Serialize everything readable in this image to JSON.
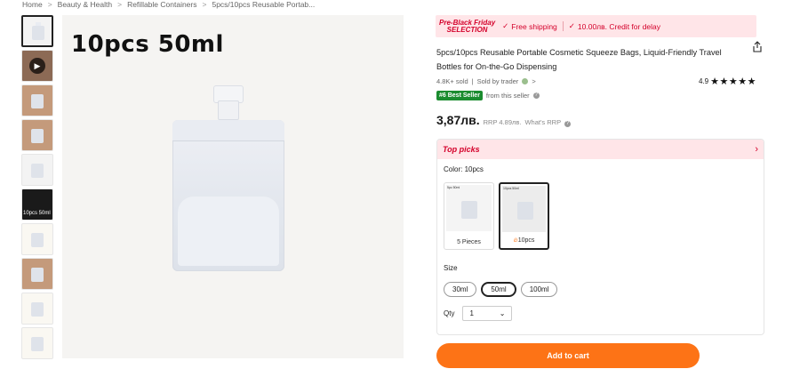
{
  "breadcrumb": {
    "items": [
      "Home",
      "Beauty & Health",
      "Refillable Containers",
      "5pcs/10pcs Reusable Portab..."
    ],
    "separator": ">"
  },
  "gallery": {
    "overlay_text": "10pcs 50ml",
    "thumbnails": [
      {
        "label": "",
        "selected": true
      },
      {
        "label": "",
        "icon": "play-icon"
      },
      {
        "label": ""
      },
      {
        "label": ""
      },
      {
        "label": ""
      },
      {
        "label": "10pcs 50ml"
      },
      {
        "label": ""
      },
      {
        "label": ""
      },
      {
        "label": ""
      },
      {
        "label": ""
      }
    ]
  },
  "promo": {
    "brand_line1": "Pre-Black Friday",
    "brand_line2": "SELECTION",
    "free_shipping": "Free shipping",
    "credit": "10.00лв. Credit for delay",
    "color": "#d4002a",
    "background": "#ffe5e8"
  },
  "product": {
    "title": "5pcs/10pcs Reusable Portable Cosmetic Squeeze Bags, Liquid-Friendly Travel Bottles for On-the-Go Dispensing",
    "sold": "4.8K+ sold",
    "seller": "Sold by trader",
    "rating": "4.9",
    "stars": "★★★★★",
    "best_seller_badge": "#6 Best Seller",
    "best_seller_text": "from this seller",
    "price": "3,87лв.",
    "rrp": "RRP 4.89лв.",
    "rrp_link": "What's RRP"
  },
  "options": {
    "top_picks_label": "Top picks",
    "color_label": "Color: 10pcs",
    "variants": [
      {
        "label": "5 Pieces",
        "image_text": "5pc 50ml",
        "selected": false
      },
      {
        "label": "10pcs",
        "image_text": "10pcs 50ml",
        "selected": true,
        "hot": true
      }
    ],
    "size_label": "Size",
    "sizes": [
      {
        "label": "30ml",
        "selected": false
      },
      {
        "label": "50ml",
        "selected": true
      },
      {
        "label": "100ml",
        "selected": false
      }
    ],
    "qty_label": "Qty",
    "qty_value": "1"
  },
  "actions": {
    "add_to_cart": "Add to cart",
    "accent": "#fd7316"
  }
}
